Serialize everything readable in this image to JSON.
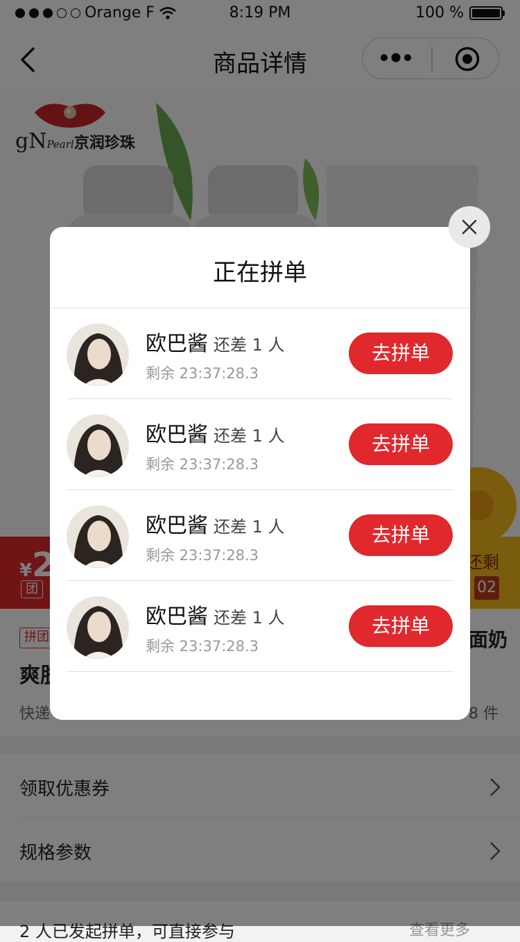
{
  "status_bar": {
    "carrier": "Orange F",
    "time": "8:19 PM",
    "battery": "100 %",
    "signal_filled": 3,
    "signal_total": 5
  },
  "nav": {
    "title": "商品详情"
  },
  "product": {
    "brand_text": "gN",
    "brand_pearl": "Pearl",
    "brand_cn": "京润珍珠",
    "price_symbol": "¥",
    "price_visible": "2",
    "group_tag": "团",
    "still_left": "还剩",
    "countdown_value": "02",
    "pintuan_tag": "拼团",
    "title_left_visible": "爽肤",
    "title_right_visible": "面奶",
    "express_visible": "快递",
    "stock_visible": "8 件"
  },
  "menu": {
    "coupon": "领取优惠券",
    "specs": "规格参数",
    "bottom_partial": "2 人已发起拼单，可直接参与",
    "bottom_more": "查看更多"
  },
  "modal": {
    "title": "正在拼单",
    "rows": [
      {
        "name": "欧巴酱",
        "need": "还差 1 人",
        "remain": "剩余 23:37:28.3",
        "button": "去拼单"
      },
      {
        "name": "欧巴酱",
        "need": "还差 1 人",
        "remain": "剩余 23:37:28.3",
        "button": "去拼单"
      },
      {
        "name": "欧巴酱",
        "need": "还差 1 人",
        "remain": "剩余 23:37:28.3",
        "button": "去拼单"
      },
      {
        "name": "欧巴酱",
        "need": "还差 1 人",
        "remain": "剩余 23:37:28.3",
        "button": "去拼单"
      }
    ]
  },
  "colors": {
    "accent_red": "#e0282d",
    "accent_yellow": "#f5b91d",
    "overlay": "rgba(0,0,0,0.5)"
  },
  "icons": [
    "wifi-icon",
    "battery-icon",
    "back-arrow-icon",
    "more-dots-icon",
    "target-icon",
    "close-icon",
    "chevron-right-icon"
  ]
}
